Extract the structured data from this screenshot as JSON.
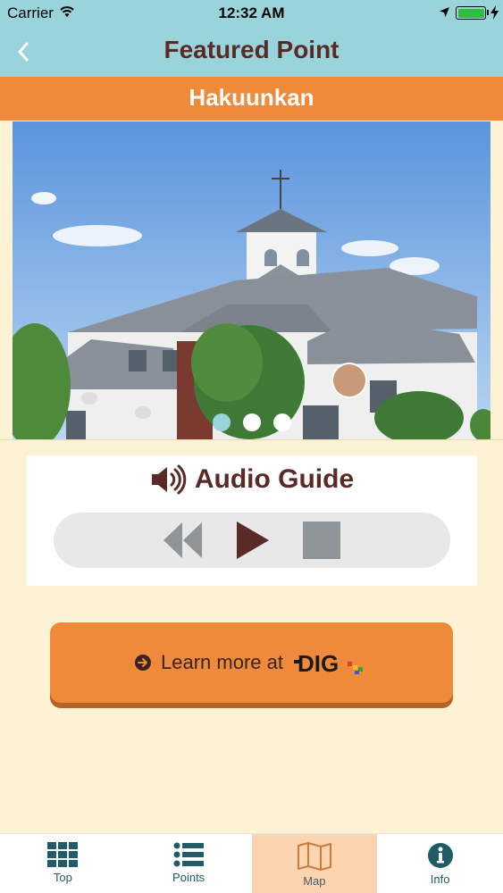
{
  "status_bar": {
    "carrier": "Carrier",
    "time": "12:32 AM"
  },
  "nav": {
    "title": "Featured Point",
    "back_icon": "chevron-left-icon"
  },
  "point": {
    "name": "Hakuunkan"
  },
  "carousel": {
    "slide_count": 3,
    "active_index": 0
  },
  "audio": {
    "title": "Audio Guide",
    "icon": "speaker-icon",
    "controls": [
      "rewind-icon",
      "play-icon",
      "stop-icon"
    ]
  },
  "learn_more": {
    "label": "Learn more at",
    "logo_text": "DIG"
  },
  "tabs": [
    {
      "label": "Top",
      "icon": "grid-icon"
    },
    {
      "label": "Points",
      "icon": "list-icon"
    },
    {
      "label": "Map",
      "icon": "map-icon",
      "active": true
    },
    {
      "label": "Info",
      "icon": "info-icon"
    }
  ],
  "colors": {
    "header": "#9ad4db",
    "banner": "#ee8a3a",
    "background": "#fdf3d4",
    "title_text": "#5a2a26",
    "tab_icon": "#1f5c67",
    "active_tab": "#fcd5b0"
  }
}
